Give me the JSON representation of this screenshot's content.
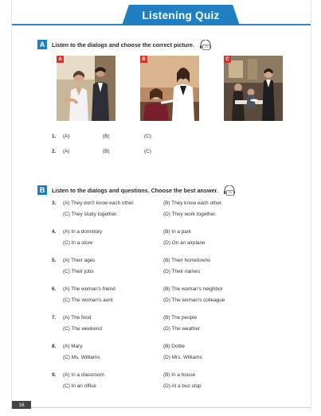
{
  "header": {
    "title": "Listening Quiz"
  },
  "section_a": {
    "letter": "A",
    "instruction": "Listen to the dialogs and choose the correct picture.",
    "track": "19",
    "photos": [
      {
        "tag": "A",
        "scene": "two-people-talking-icon"
      },
      {
        "tag": "B",
        "scene": "customer-service-desk-icon"
      },
      {
        "tag": "C",
        "scene": "restaurant-waiter-icon"
      }
    ],
    "rows": [
      {
        "num": "1.",
        "a": "(A)",
        "b": "(B)",
        "c": "(C)"
      },
      {
        "num": "2.",
        "a": "(A)",
        "b": "(B)",
        "c": "(C)"
      }
    ]
  },
  "section_b": {
    "letter": "B",
    "instruction": "Listen to the dialogs and questions. Choose the best answer.",
    "track": "20",
    "questions": [
      {
        "num": "3.",
        "a": "(A)  They don't know each other.",
        "b": "(B)  They know each other.",
        "c": "(C)  They study together.",
        "d": "(D)  They work together."
      },
      {
        "num": "4.",
        "a": "(A)  In a dormitory",
        "b": "(B)  In a park",
        "c": "(C)  In a store",
        "d": "(D)  On an airplane"
      },
      {
        "num": "5.",
        "a": "(A)  Their ages",
        "b": "(B)  Their hometowns",
        "c": "(C)  Their jobs",
        "d": "(D)  Their names"
      },
      {
        "num": "6.",
        "a": "(A)  The woman's friend",
        "b": "(B)  The woman's neighbor",
        "c": "(C)  The woman's aunt",
        "d": "(D)  The woman's colleague"
      },
      {
        "num": "7.",
        "a": "(A)  The food",
        "b": "(B)  The people",
        "c": "(C)  The weekend",
        "d": "(D)  The weather"
      },
      {
        "num": "8.",
        "a": "(A)  Mary",
        "b": "(B)  Dottie",
        "c": "(C)  Ms. Williams",
        "d": "(D)  Mrs. Williams"
      },
      {
        "num": "9.",
        "a": "(A)  In a classroom",
        "b": "(B)  In a house",
        "c": "(C)  In an office",
        "d": "(D)  At a bus stop"
      }
    ]
  },
  "footer": {
    "page_number": "16"
  },
  "colors": {
    "accent": "#1f7fc2",
    "photo_tag": "#d9342b"
  }
}
